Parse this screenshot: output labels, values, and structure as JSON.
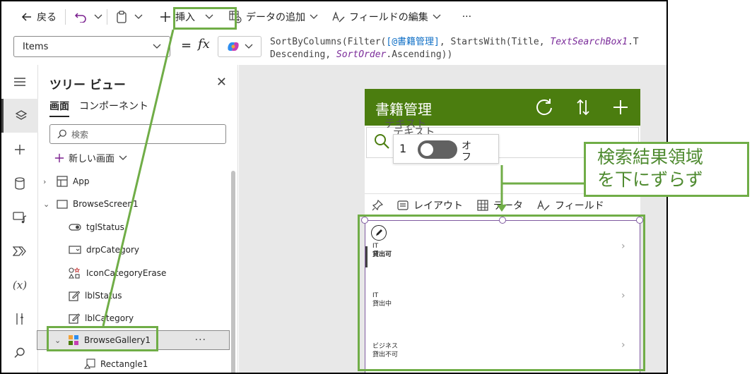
{
  "toolbar": {
    "back_label": "戻る",
    "insert_label": "挿入",
    "add_data_label": "データの追加",
    "edit_fields_label": "フィールドの編集",
    "more_label": "···"
  },
  "formula_bar": {
    "property_value": "Items",
    "equals": "=",
    "fx": "fx",
    "line1_a": "SortByColumns(Filter(",
    "line1_b": "[@書籍管理]",
    "line1_c": ", StartsWith(Title, ",
    "line1_d": "TextSearchBox1",
    "line1_e": ".T",
    "line2_a": "Descending, ",
    "line2_b": "SortOrder",
    "line2_c": ".Ascending))"
  },
  "tree": {
    "title": "ツリー ビュー",
    "tabs": [
      "画面",
      "コンポーネント"
    ],
    "search_placeholder": "検索",
    "new_screen_label": "新しい画面",
    "nodes": {
      "app": "App",
      "browse_screen": "BrowseScreen1",
      "tgl_status": "tglStatus",
      "drp_category": "drpCategory",
      "icon_category_erase": "IconCategoryErase",
      "lbl_status": "lblStatus",
      "lbl_category": "lblCategory",
      "browse_gallery": "BrowseGallery1",
      "rectangle": "Rectangle1"
    },
    "more_label": "···"
  },
  "app_preview": {
    "title": "書籍管理",
    "ghost_text_1": "テキスト",
    "ghost_text_2": "テキスト",
    "toggle_value": "1",
    "toggle_label": "オフ",
    "context_bar": {
      "layout": "レイアウト",
      "data": "データ",
      "fields": "フィールド"
    },
    "gallery_items": [
      {
        "category": "IT",
        "status": "貸出可"
      },
      {
        "category": "IT",
        "status": "貸出中"
      },
      {
        "category": "ビジネス",
        "status": "貸出不可"
      }
    ]
  },
  "annotation": {
    "line1": "検索結果領域",
    "line2": "を下にずらず",
    "accent_color": "#70ad47"
  }
}
